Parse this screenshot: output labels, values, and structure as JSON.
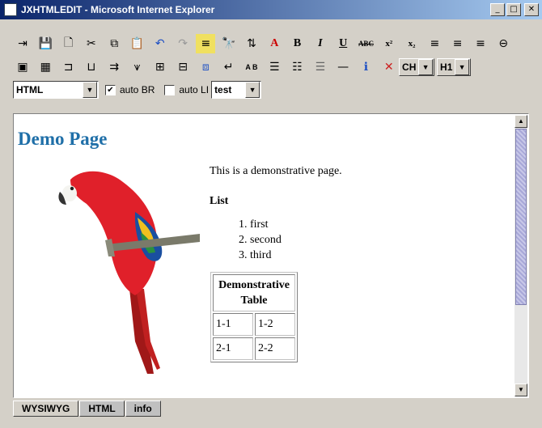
{
  "window": {
    "title": "JXHTMLEDIT - Microsoft Internet Explorer"
  },
  "toolbar_row1": [
    "import-icon",
    "save-icon",
    "new-icon",
    "cut-icon",
    "copy-icon",
    "paste-icon",
    "undo-icon",
    "redo-icon",
    "highlight-icon",
    "find-icon",
    "replace-icon",
    "font-color-icon",
    "bold-icon",
    "italic-icon",
    "underline-icon",
    "strikethrough-icon",
    "superscript-icon",
    "subscript-icon",
    "align-left-icon",
    "align-center-icon",
    "align-right-icon",
    "link-icon"
  ],
  "toolbar_row2": [
    "image-icon",
    "table-icon",
    "insert-row-icon",
    "insert-col-icon",
    "delete-row-icon",
    "delete-col-icon",
    "merge-cells-icon",
    "split-cells-icon",
    "layers-icon",
    "line-break-icon",
    "small-caps-icon",
    "bullet-list-icon",
    "numbered-list-icon",
    "indent-list-icon",
    "horizontal-rule-icon",
    "info-icon",
    "delete-icon"
  ],
  "toolbar_text": {
    "bold": "B",
    "italic": "I",
    "underline": "U",
    "strike": "ABC",
    "super": "x²",
    "sub": "x₂",
    "smallcaps": "A B"
  },
  "selects": {
    "lang": "CH",
    "heading": "H1",
    "view": "HTML",
    "style": "test"
  },
  "options": {
    "auto_br_label": "auto BR",
    "auto_br_checked": true,
    "auto_li_label": "auto LI",
    "auto_li_checked": false
  },
  "document": {
    "title": "Demo Page",
    "paragraph": "This is a demonstrative page.",
    "list_heading": "List",
    "list_items": [
      "first",
      "second",
      "third"
    ],
    "table": {
      "header": "Demonstrative Table",
      "rows": [
        [
          "1-1",
          "1-2"
        ],
        [
          "2-1",
          "2-2"
        ]
      ]
    }
  },
  "tabs": [
    "WYSIWYG",
    "HTML",
    "info"
  ],
  "active_tab": "WYSIWYG",
  "colors": {
    "title_blue": "#1f6fa8",
    "titlebar": "#0a246a",
    "info_blue": "#1d4fc4",
    "delete_red": "#cc2020"
  }
}
